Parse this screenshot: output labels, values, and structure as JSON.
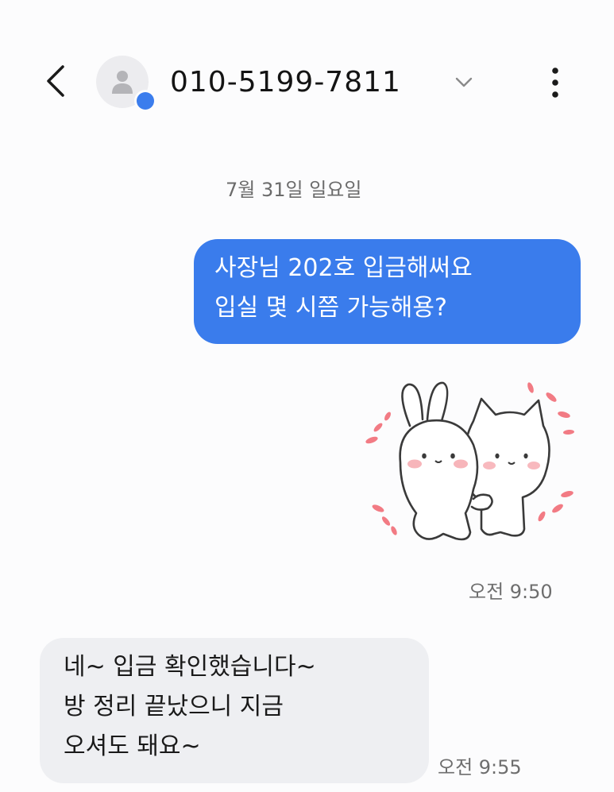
{
  "header": {
    "back_icon": "chevron-left-icon",
    "avatar_icon": "person-icon",
    "contact_name": "010-5199-7811",
    "dropdown_icon": "chevron-down-icon",
    "more_icon": "more-vertical-icon"
  },
  "conversation": {
    "date_divider": "7월 31일 일요일",
    "messages": [
      {
        "direction": "outgoing",
        "text": "사장님 202호 입금해써요\n입실 몇 시쯤 가능해용?"
      },
      {
        "direction": "outgoing",
        "sticker": "hugging-bunny-cat-sticker",
        "time": "오전 9:50"
      },
      {
        "direction": "incoming",
        "text": "네~ 입금 확인했습니다~\n방 정리 끝났으니 지금\n오셔도 돼요~",
        "time": "오전 9:55"
      }
    ]
  },
  "colors": {
    "outgoing_bubble": "#3a7cec",
    "incoming_bubble": "#eeeff2",
    "background": "#fcfcfd",
    "badge": "#3b7ded"
  }
}
